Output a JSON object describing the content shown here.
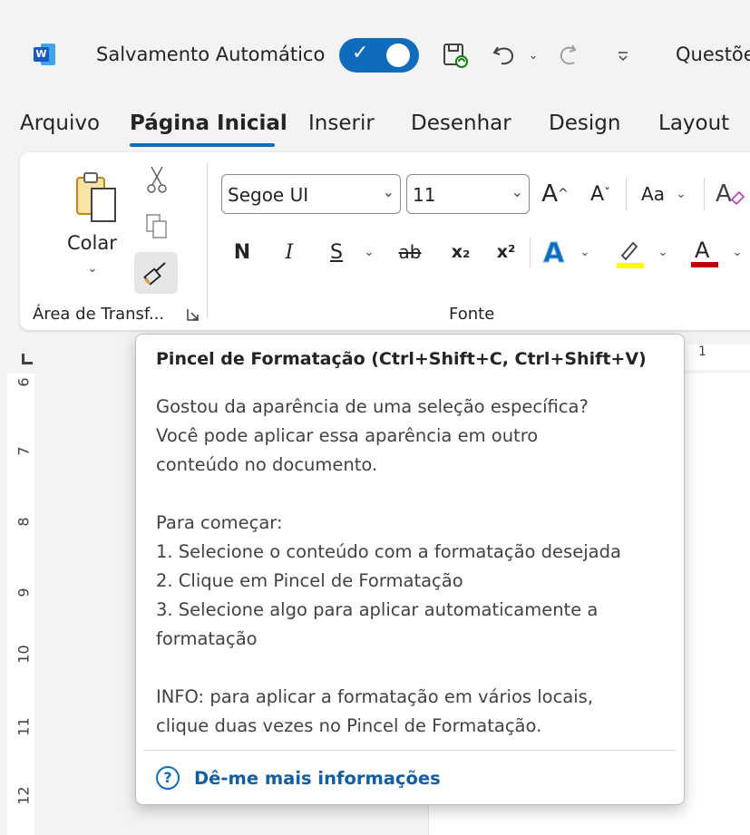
{
  "titlebar": {
    "app_icon": "word-icon",
    "autosave_label": "Salvamento Automático",
    "autosave_on": true,
    "doc_title": "Questõe"
  },
  "tabs": [
    {
      "label": "Arquivo"
    },
    {
      "label": "Página Inicial",
      "active": true
    },
    {
      "label": "Inserir"
    },
    {
      "label": "Desenhar"
    },
    {
      "label": "Design"
    },
    {
      "label": "Layout"
    }
  ],
  "clipboard": {
    "paste_label": "Colar",
    "group_label": "Área de Transf..."
  },
  "font": {
    "font_name": "Segoe UI",
    "font_size": "11",
    "group_label": "Fonte",
    "change_case_label": "Aa",
    "bold_label": "N",
    "italic_label": "I",
    "underline_label": "S",
    "strike_label": "ab",
    "subscript_label": "x₂",
    "superscript_label": "x²",
    "highlight_color": "#ffff00",
    "font_color": "#c00000"
  },
  "ruler": {
    "vertical_numbers": [
      "6",
      "7",
      "8",
      "9",
      "10",
      "11",
      "12"
    ],
    "horizontal_number": "1"
  },
  "tooltip": {
    "title": "Pincel de Formatação (Ctrl+Shift+C, Ctrl+Shift+V)",
    "lines": [
      "Gostou da aparência de uma seleção específica?",
      "Você pode aplicar essa aparência em outro",
      "conteúdo no documento.",
      "Para começar:",
      "1. Selecione o conteúdo com a formatação desejada",
      "2. Clique em Pincel de Formatação",
      "3. Selecione algo para aplicar automaticamente a",
      "formatação",
      "INFO: para aplicar a formatação em vários locais,",
      "clique duas vezes no Pincel de Formatação."
    ],
    "help_link": "Dê-me mais informações"
  },
  "colors": {
    "accent": "#0f6cbd",
    "word_brand": "#185abd"
  }
}
